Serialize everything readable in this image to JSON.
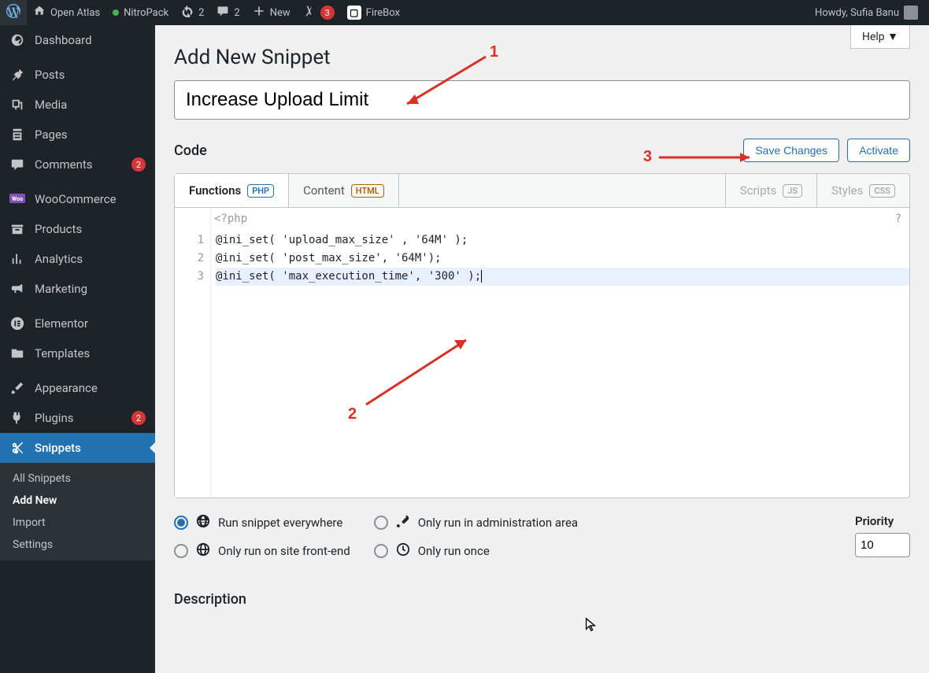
{
  "adminbar": {
    "site_name": "Open Atlas",
    "nitropack": "NitroPack",
    "updates_count": "2",
    "comments_count": "2",
    "new_label": "New",
    "yoast_count": "3",
    "firebox": "FireBox",
    "greeting": "Howdy, Sufia Banu"
  },
  "menu": {
    "dashboard": "Dashboard",
    "posts": "Posts",
    "media": "Media",
    "pages": "Pages",
    "comments": "Comments",
    "comments_count": "2",
    "woocommerce": "WooCommerce",
    "products": "Products",
    "analytics": "Analytics",
    "marketing": "Marketing",
    "elementor": "Elementor",
    "templates": "Templates",
    "appearance": "Appearance",
    "plugins": "Plugins",
    "plugins_count": "2",
    "snippets": "Snippets",
    "sub_all": "All Snippets",
    "sub_addnew": "Add New",
    "sub_import": "Import",
    "sub_settings": "Settings"
  },
  "page": {
    "help": "Help ▼",
    "title": "Add New Snippet",
    "snippet_title_value": "Increase Upload Limit",
    "section_code": "Code",
    "btn_save": "Save Changes",
    "btn_activate": "Activate",
    "tab_functions": "Functions",
    "tab_functions_lang": "PHP",
    "tab_content": "Content",
    "tab_content_lang": "HTML",
    "tab_scripts": "Scripts",
    "tab_scripts_lang": "JS",
    "tab_styles": "Styles",
    "tab_styles_lang": "CSS",
    "php_opening": "<?php",
    "code_line1": "@ini_set( 'upload_max_size' , '64M' );",
    "code_line2": "@ini_set( 'post_max_size', '64M');",
    "code_line3": "@ini_set( 'max_execution_time', '300' );",
    "scope_everywhere": "Run snippet everywhere",
    "scope_admin": "Only run in administration area",
    "scope_front": "Only run on site front-end",
    "scope_once": "Only run once",
    "priority_label": "Priority",
    "priority_value": "10",
    "section_description": "Description"
  },
  "annotations": {
    "a1": "1",
    "a2": "2",
    "a3": "3"
  }
}
